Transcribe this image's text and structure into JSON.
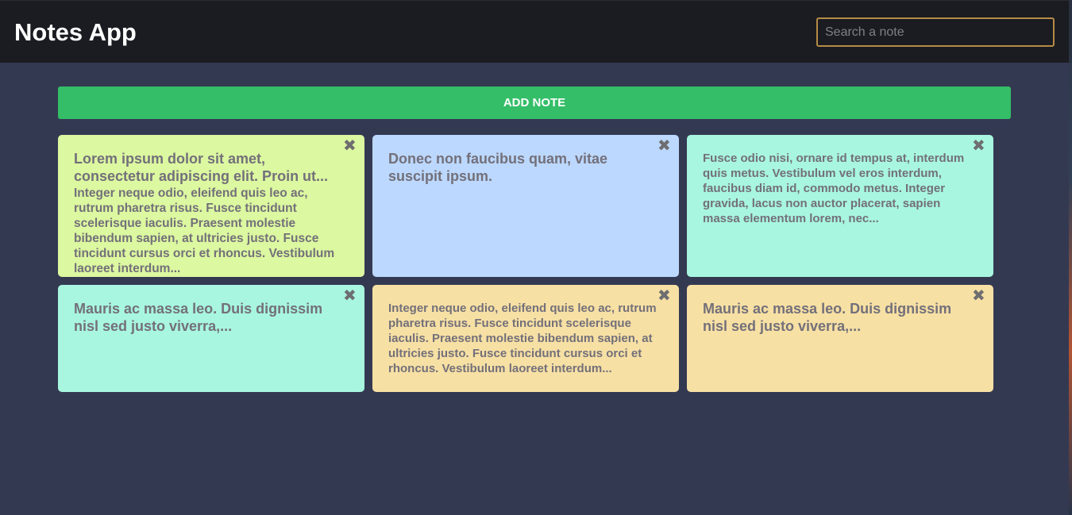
{
  "header": {
    "title": "Notes App",
    "search": {
      "placeholder": "Search a note",
      "value": ""
    }
  },
  "toolbar": {
    "add_note_label": "ADD NOTE"
  },
  "notes": [
    {
      "title": "Lorem ipsum dolor sit amet, consectetur adipiscing elit. Proin ut...",
      "body": "Integer neque odio, eleifend quis leo ac, rutrum pharetra risus. Fusce tincidunt scelerisque iaculis. Praesent molestie bibendum sapien, at ultricies justo. Fusce tincidunt cursus orci et rhoncus. Vestibulum laoreet interdum...",
      "color": "#dcf8a0",
      "close_label": "✖"
    },
    {
      "title": "Donec non faucibus quam, vitae suscipit ipsum.",
      "body": "",
      "color": "#bcd8ff",
      "close_label": "✖"
    },
    {
      "title": "",
      "body": "Fusce odio nisi, ornare id tempus at, interdum quis metus. Vestibulum vel eros interdum, faucibus diam id, commodo metus. Integer gravida, lacus non auctor placerat, sapien massa elementum lorem, nec...",
      "color": "#a8f6df",
      "close_label": "✖"
    },
    {
      "title": "Mauris ac massa leo. Duis dignissim nisl sed justo viverra,...",
      "body": "",
      "color": "#a8f6df",
      "close_label": "✖"
    },
    {
      "title": "",
      "body": "Integer neque odio, eleifend quis leo ac, rutrum pharetra risus. Fusce tincidunt scelerisque iaculis. Praesent molestie bibendum sapien, at ultricies justo. Fusce tincidunt cursus orci et rhoncus. Vestibulum laoreet interdum...",
      "color": "#f7e0a4",
      "close_label": "✖"
    },
    {
      "title": "Mauris ac massa leo. Duis dignissim nisl sed justo viverra,...",
      "body": "",
      "color": "#f7e0a4",
      "close_label": "✖"
    }
  ],
  "colors": {
    "background": "#343952",
    "header": "#1b1c21",
    "accent": "#35be68",
    "search_border": "#b58b46"
  },
  "icons": {
    "close": "close-icon"
  }
}
